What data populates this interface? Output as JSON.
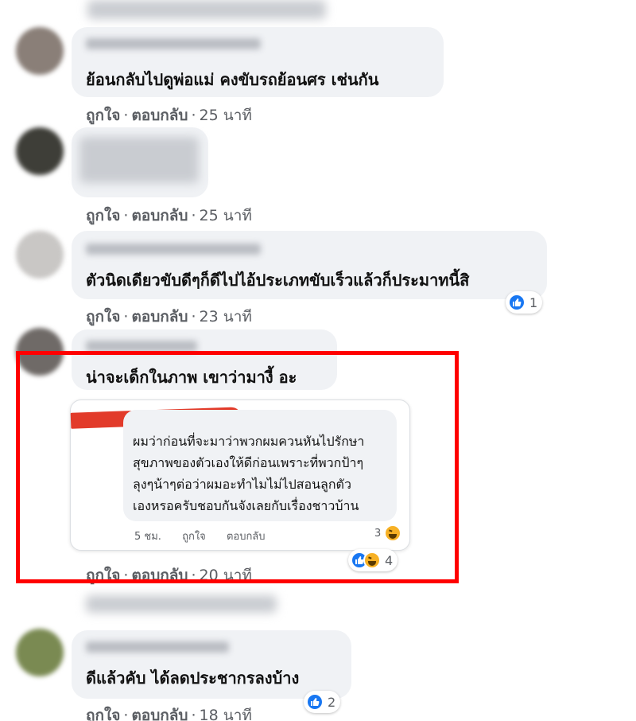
{
  "comments": [
    {
      "text": "ย้อนกลับไปดูพ่อแม่ คงขับรถย้อนศร เช่นกัน",
      "like": "ถูกใจ",
      "reply": "ตอบกลับ",
      "time": "25 นาที"
    },
    {
      "text": "",
      "like": "ถูกใจ",
      "reply": "ตอบกลับ",
      "time": "25 นาที"
    },
    {
      "text": "ตัวนิดเดียวขับดีๆก็ดีไปไอ้ประเภทขับเร็วแล้วก็ประมาทนี้สิ",
      "like": "ถูกใจ",
      "reply": "ตอบกลับ",
      "time": "23 นาที",
      "reactions": "1"
    },
    {
      "text": "น่าจะเด็กในภาพ เขาว่ามางี้ อะ",
      "like": "ถูกใจ",
      "reply": "ตอบกลับ",
      "time": "20 นาที"
    },
    {
      "text": "ดีแล้วคับ ได้ลดประชากรลงบ้าง",
      "like": "ถูกใจ",
      "reply": "ตอบกลับ",
      "time": "18 นาที",
      "reactions": "2"
    }
  ],
  "embedded": {
    "lines": [
      "ผมว่าก่อนที่จะมาว่าพวกผมควนหันไปรักษา",
      "สุขภาพของตัวเองให้ดีก่อนเพราะที่พวกป้าๆ",
      "ลุงๆน้าๆต่อว่าผมอะทำไมไม่ไปสอนลูกตัว",
      "เองหรอครับชอบกันจังเลยกับเรื่องชาวบ้าน"
    ],
    "time": "5 ชม.",
    "like": "ถูกใจ",
    "reply": "ตอบกลับ",
    "reactions": "3",
    "outer_reactions": "4"
  },
  "colors": {
    "highlight": "#ff0000",
    "like_blue": "#1877f2",
    "bubble": "#f0f2f5",
    "redaction": "#e23b2a"
  }
}
